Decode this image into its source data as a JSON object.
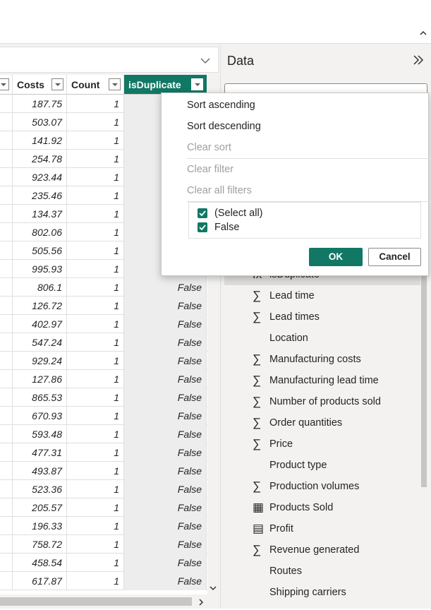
{
  "grid": {
    "headers": [
      "Costs",
      "Count",
      "isDuplicate"
    ],
    "rows": [
      {
        "costs": "187.75",
        "count": "1",
        "dup": ""
      },
      {
        "costs": "503.07",
        "count": "1",
        "dup": ""
      },
      {
        "costs": "141.92",
        "count": "1",
        "dup": ""
      },
      {
        "costs": "254.78",
        "count": "1",
        "dup": ""
      },
      {
        "costs": "923.44",
        "count": "1",
        "dup": ""
      },
      {
        "costs": "235.46",
        "count": "1",
        "dup": ""
      },
      {
        "costs": "134.37",
        "count": "1",
        "dup": ""
      },
      {
        "costs": "802.06",
        "count": "1",
        "dup": ""
      },
      {
        "costs": "505.56",
        "count": "1",
        "dup": ""
      },
      {
        "costs": "995.93",
        "count": "1",
        "dup": ""
      },
      {
        "costs": "806.1",
        "count": "1",
        "dup": "False"
      },
      {
        "costs": "126.72",
        "count": "1",
        "dup": "False"
      },
      {
        "costs": "402.97",
        "count": "1",
        "dup": "False"
      },
      {
        "costs": "547.24",
        "count": "1",
        "dup": "False"
      },
      {
        "costs": "929.24",
        "count": "1",
        "dup": "False"
      },
      {
        "costs": "127.86",
        "count": "1",
        "dup": "False"
      },
      {
        "costs": "865.53",
        "count": "1",
        "dup": "False"
      },
      {
        "costs": "670.93",
        "count": "1",
        "dup": "False"
      },
      {
        "costs": "593.48",
        "count": "1",
        "dup": "False"
      },
      {
        "costs": "477.31",
        "count": "1",
        "dup": "False"
      },
      {
        "costs": "493.87",
        "count": "1",
        "dup": "False"
      },
      {
        "costs": "523.36",
        "count": "1",
        "dup": "False"
      },
      {
        "costs": "205.57",
        "count": "1",
        "dup": "False"
      },
      {
        "costs": "196.33",
        "count": "1",
        "dup": "False"
      },
      {
        "costs": "758.72",
        "count": "1",
        "dup": "False"
      },
      {
        "costs": "458.54",
        "count": "1",
        "dup": "False"
      },
      {
        "costs": "617.87",
        "count": "1",
        "dup": "False"
      }
    ]
  },
  "data_pane": {
    "title": "Data",
    "fields": [
      {
        "label": "isDuplicate",
        "icon": "calculated-column-icon",
        "glyph": "fx",
        "highlighted": true
      },
      {
        "label": "Lead time",
        "icon": "sigma-icon",
        "glyph": "∑"
      },
      {
        "label": "Lead times",
        "icon": "sigma-icon",
        "glyph": "∑"
      },
      {
        "label": "Location",
        "icon": "",
        "glyph": ""
      },
      {
        "label": "Manufacturing costs",
        "icon": "sigma-icon",
        "glyph": "∑"
      },
      {
        "label": "Manufacturing lead time",
        "icon": "sigma-icon",
        "glyph": "∑"
      },
      {
        "label": "Number of products sold",
        "icon": "sigma-icon",
        "glyph": "∑"
      },
      {
        "label": "Order quantities",
        "icon": "sigma-icon",
        "glyph": "∑"
      },
      {
        "label": "Price",
        "icon": "sigma-icon",
        "glyph": "∑"
      },
      {
        "label": "Product type",
        "icon": "",
        "glyph": ""
      },
      {
        "label": "Production volumes",
        "icon": "sigma-icon",
        "glyph": "∑"
      },
      {
        "label": "Products Sold",
        "icon": "calculator-icon",
        "glyph": "▦"
      },
      {
        "label": "Profit",
        "icon": "measure-icon",
        "glyph": "▤"
      },
      {
        "label": "Revenue generated",
        "icon": "sigma-icon",
        "glyph": "∑"
      },
      {
        "label": "Routes",
        "icon": "",
        "glyph": ""
      },
      {
        "label": "Shipping carriers",
        "icon": "",
        "glyph": ""
      }
    ]
  },
  "dropdown": {
    "sort_ascending": "Sort ascending",
    "sort_descending": "Sort descending",
    "clear_sort": "Clear sort",
    "clear_filter": "Clear filter",
    "clear_all_filters": "Clear all filters",
    "select_all": "(Select all)",
    "false_option": "False",
    "ok": "OK",
    "cancel": "Cancel"
  },
  "colors": {
    "accent": "#117865",
    "pane_bg": "#f3f2f1"
  }
}
